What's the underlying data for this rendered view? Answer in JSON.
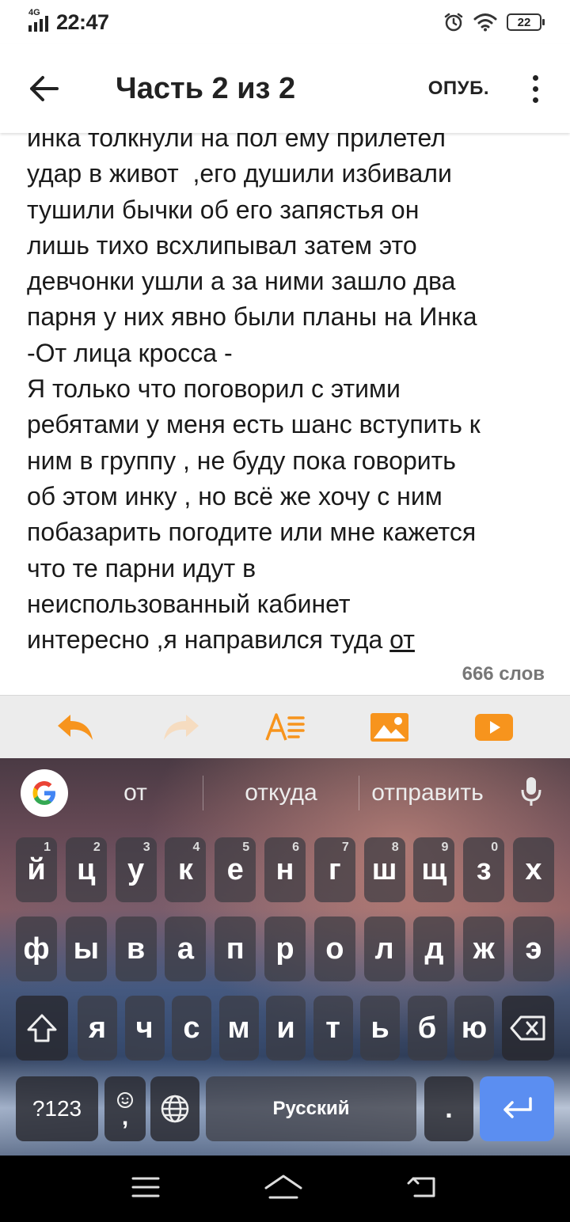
{
  "status_bar": {
    "network": "4G",
    "time": "22:47",
    "battery": "22"
  },
  "header": {
    "title": "Часть 2 из 2",
    "publish_label": "ОПУБ."
  },
  "editor": {
    "lines": [
      "инка толкнули на пол ему прилетел",
      "удар в живот  ,его душили избивали",
      "тушили бычки об его запястья он",
      "лишь тихо всхлипывал затем это",
      "девчонки ушли а за ними зашло два",
      "парня у них явно были планы на Инка",
      "-От лица кросса -",
      "Я только что поговорил с этими",
      "ребятами у меня есть шанс вступить к",
      "ним в группу , не буду пока говорить",
      "об этом инку , но всё же хочу с ним",
      "побазарить погодите или мне кажется",
      "что те парни идут в",
      "неиспользованный кабинет"
    ],
    "last_line_text": "интересно ,я направился туда ",
    "last_line_underlined": "от",
    "word_count": "666 слов"
  },
  "toolbar": {
    "accent_color": "#f7941d",
    "items": [
      "undo-icon",
      "redo-icon",
      "text-format-icon",
      "image-icon",
      "video-icon"
    ]
  },
  "keyboard": {
    "suggestions": [
      "от",
      "откуда",
      "отправить"
    ],
    "rows": [
      [
        [
          "й",
          "1"
        ],
        [
          "ц",
          "2"
        ],
        [
          "у",
          "3"
        ],
        [
          "к",
          "4"
        ],
        [
          "е",
          "5"
        ],
        [
          "н",
          "6"
        ],
        [
          "г",
          "7"
        ],
        [
          "ш",
          "8"
        ],
        [
          "щ",
          "9"
        ],
        [
          "з",
          "0"
        ],
        [
          "х",
          ""
        ]
      ],
      [
        [
          "ф",
          ""
        ],
        [
          "ы",
          ""
        ],
        [
          "в",
          ""
        ],
        [
          "а",
          ""
        ],
        [
          "п",
          ""
        ],
        [
          "р",
          ""
        ],
        [
          "о",
          ""
        ],
        [
          "л",
          ""
        ],
        [
          "д",
          ""
        ],
        [
          "ж",
          ""
        ],
        [
          "э",
          ""
        ]
      ],
      [
        [
          "я",
          ""
        ],
        [
          "ч",
          ""
        ],
        [
          "с",
          ""
        ],
        [
          "м",
          ""
        ],
        [
          "и",
          ""
        ],
        [
          "т",
          ""
        ],
        [
          "ь",
          ""
        ],
        [
          "б",
          ""
        ],
        [
          "ю",
          ""
        ]
      ]
    ],
    "symbols_label": "?123",
    "comma_label": ",",
    "space_label": "Русский",
    "period_label": "."
  }
}
